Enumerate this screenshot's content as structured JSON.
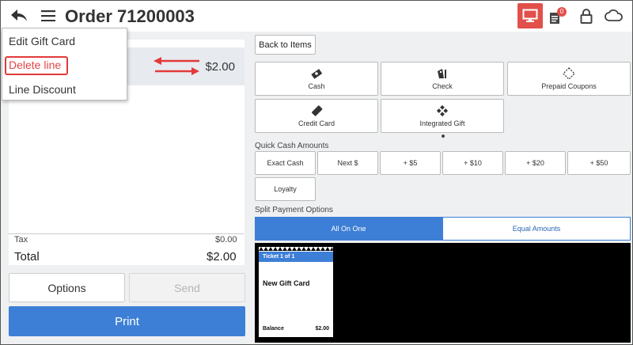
{
  "header": {
    "title": "Order 71200003",
    "icons": [
      "back-arrow-icon",
      "hamburger-menu-icon",
      "display-icon",
      "tickets-icon",
      "lock-icon",
      "cloud-icon"
    ],
    "tickets_badge": "0",
    "accent_color": "#e2504b"
  },
  "cart": {
    "line_price": "$2.00",
    "line_sub": ")",
    "tax_label": "Tax",
    "tax_value": "$0.00",
    "total_label": "Total",
    "total_value": "$2.00"
  },
  "context_menu": {
    "items": [
      "Edit Gift Card",
      "Delete line",
      "Line Discount"
    ]
  },
  "actions": {
    "options": "Options",
    "send": "Send",
    "print": "Print"
  },
  "payment": {
    "back_to_items": "Back to Items",
    "tiles": [
      {
        "label": "Cash",
        "icon": "cash-icon"
      },
      {
        "label": "Check",
        "icon": "check-icon"
      },
      {
        "label": "Prepaid Coupons",
        "icon": "coupon-icon"
      },
      {
        "label": "Credit Card",
        "icon": "credit-card-icon"
      },
      {
        "label": "Integrated Gift",
        "icon": "gift-icon"
      }
    ]
  },
  "quick_cash": {
    "label": "Quick Cash Amounts",
    "buttons": [
      "Exact Cash",
      "Next $",
      "+ $5",
      "+ $10",
      "+ $20",
      "+ $50",
      "Loyalty"
    ]
  },
  "split": {
    "label": "Split Payment Options",
    "all_on_one": "All On One",
    "equal_amounts": "Equal Amounts",
    "accent_color": "#3d7fd6"
  },
  "ticket": {
    "header": "Ticket 1 of 1",
    "name": "New Gift Card",
    "balance_label": "Balance",
    "balance_value": "$2.00"
  }
}
